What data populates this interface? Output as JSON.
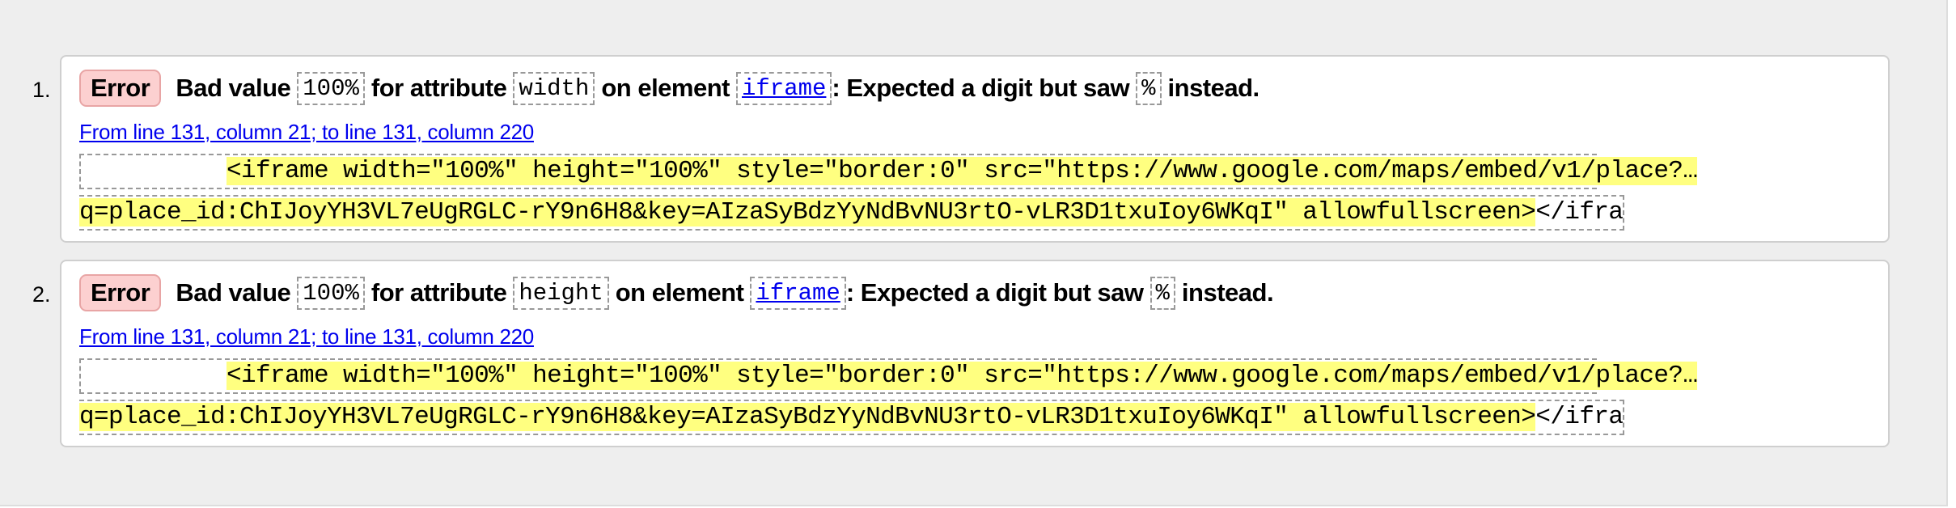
{
  "errors": [
    {
      "number": "1.",
      "badge": "Error",
      "msg_prefix": "Bad value",
      "value": "100%",
      "msg_attr": "for attribute",
      "attribute": "width",
      "msg_elem": "on element",
      "element": "iframe",
      "msg_expected": ": Expected a digit but saw",
      "char": "%",
      "msg_suffix": "instead.",
      "location": "From line 131, column 21; to line 131, column 220",
      "extract_indent": "          ",
      "extract_line1": "<iframe width=\"100%\" height=\"100%\" style=\"border:0\" src=\"https://www.google.com/maps/embed/v1/place?…",
      "extract_line2_hl": "q=place_id:ChIJoyYH3VL7eUgRGLC-rY9n6H8&key=AIzaSyBdzYyNdBvNU3rtO-vLR3D1txuIoy6WKqI\" allowfullscreen>",
      "extract_line2_tail": "</ifra"
    },
    {
      "number": "2.",
      "badge": "Error",
      "msg_prefix": "Bad value",
      "value": "100%",
      "msg_attr": "for attribute",
      "attribute": "height",
      "msg_elem": "on element",
      "element": "iframe",
      "msg_expected": ": Expected a digit but saw",
      "char": "%",
      "msg_suffix": "instead.",
      "location": "From line 131, column 21; to line 131, column 220",
      "extract_indent": "          ",
      "extract_line1": "<iframe width=\"100%\" height=\"100%\" style=\"border:0\" src=\"https://www.google.com/maps/embed/v1/place?…",
      "extract_line2_hl": "q=place_id:ChIJoyYH3VL7eUgRGLC-rY9n6H8&key=AIzaSyBdzYyNdBvNU3rtO-vLR3D1txuIoy6WKqI\" allowfullscreen>",
      "extract_line2_tail": "</ifra"
    }
  ]
}
